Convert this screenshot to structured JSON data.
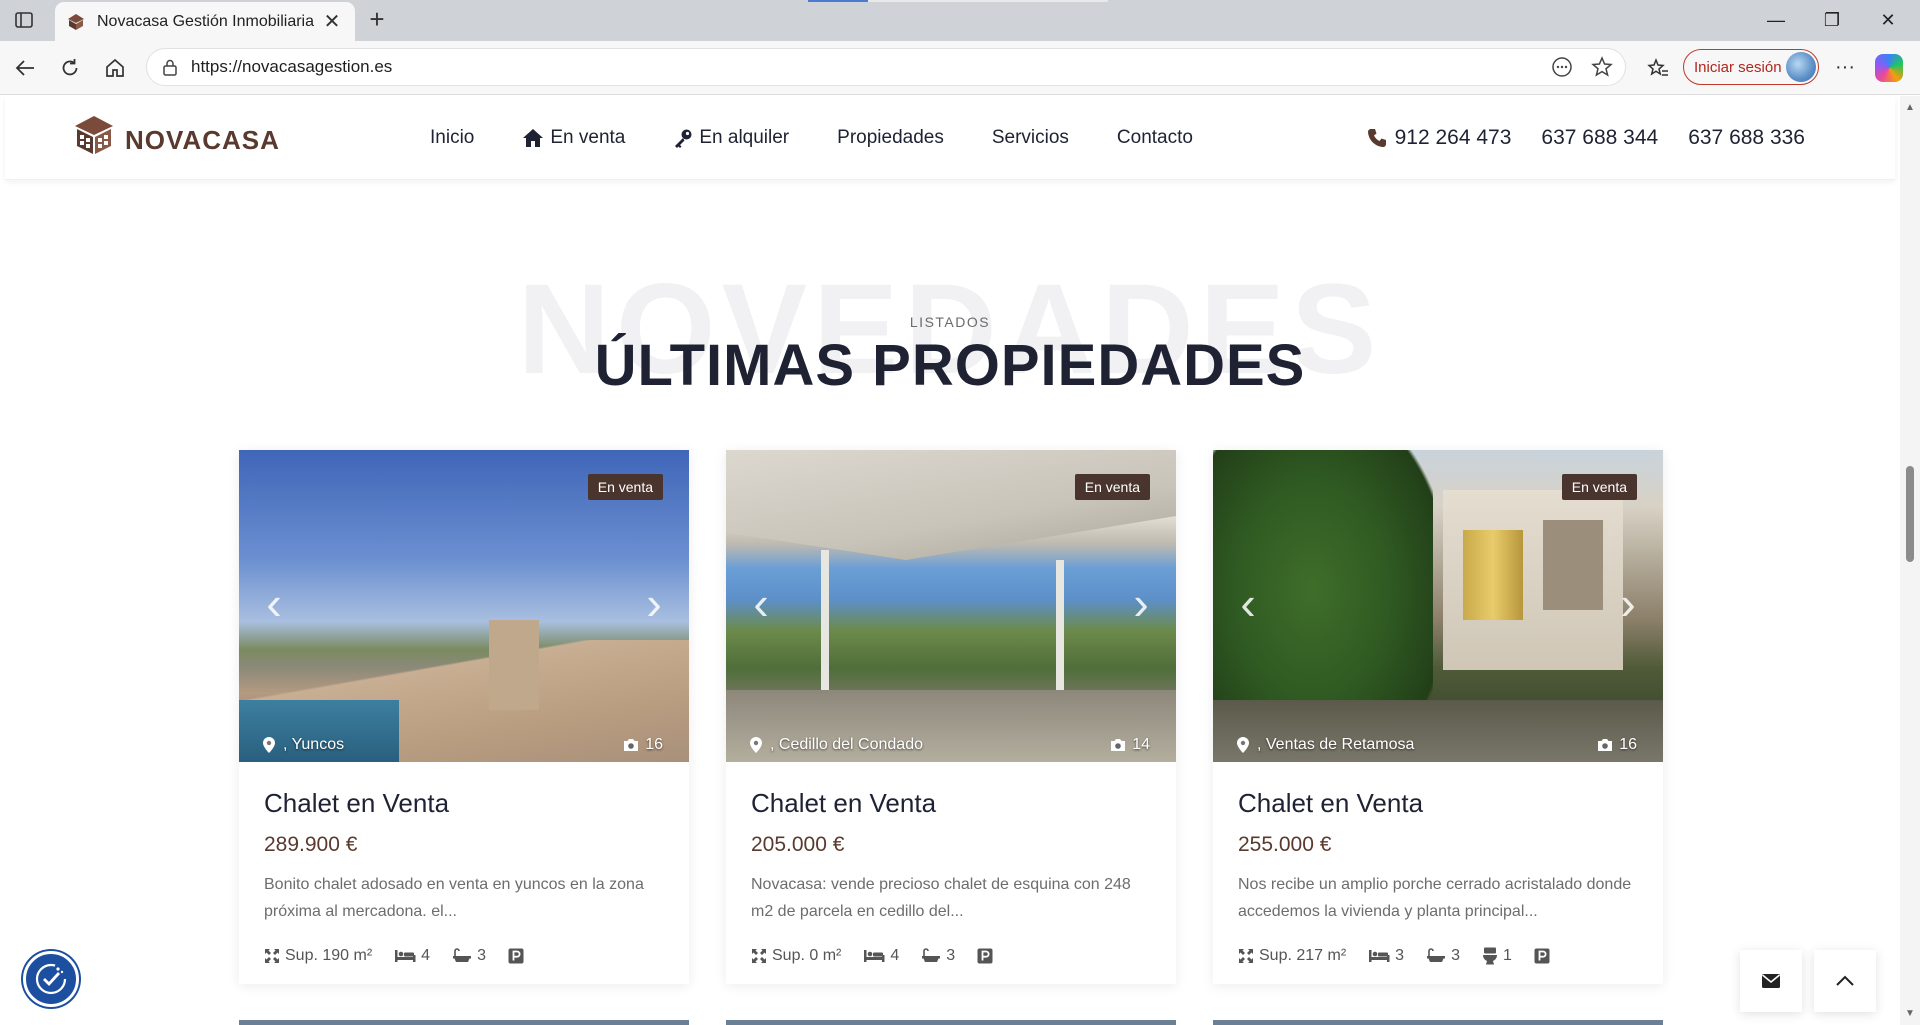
{
  "browser": {
    "tab_title": "Novacasa Gestión Inmobiliaria",
    "url": "https://novacasagestion.es",
    "signin_label": "Iniciar sesión"
  },
  "header": {
    "logo_text": "NOVACASA",
    "nav": [
      {
        "label": "Inicio",
        "icon": ""
      },
      {
        "label": "En venta",
        "icon": "home-icon"
      },
      {
        "label": "En alquiler",
        "icon": "key-icon"
      },
      {
        "label": "Propiedades",
        "icon": ""
      },
      {
        "label": "Servicios",
        "icon": ""
      },
      {
        "label": "Contacto",
        "icon": ""
      }
    ],
    "phones": [
      "912 264 473",
      "637 688 344",
      "637 688 336"
    ]
  },
  "section": {
    "background_word": "NOVEDADES",
    "kicker": "LISTADOS",
    "title": "ÚLTIMAS PROPIEDADES"
  },
  "listings": [
    {
      "badge": "En venta",
      "location": ", Yuncos",
      "photo_count": "16",
      "title": "Chalet en Venta",
      "price": "289.900 €",
      "description": "Bonito chalet adosado en venta en yuncos en la zona próxima al mercadona. el...",
      "surface": "Sup. 190 m²",
      "bedrooms": "4",
      "bathrooms": "3",
      "toilets": "",
      "parking": true
    },
    {
      "badge": "En venta",
      "location": ", Cedillo del Condado",
      "photo_count": "14",
      "title": "Chalet en Venta",
      "price": "205.000 €",
      "description": "Novacasa: vende precioso chalet de esquina con 248 m2 de parcela en cedillo del...",
      "surface": "Sup. 0 m²",
      "bedrooms": "4",
      "bathrooms": "3",
      "toilets": "",
      "parking": true
    },
    {
      "badge": "En venta",
      "location": ", Ventas de Retamosa",
      "photo_count": "16",
      "title": "Chalet en Venta",
      "price": "255.000 €",
      "description": "Nos recibe un amplio porche cerrado acristalado donde accedemos la vivienda y planta principal...",
      "surface": "Sup. 217 m²",
      "bedrooms": "3",
      "bathrooms": "3",
      "toilets": "1",
      "parking": true
    }
  ],
  "colors": {
    "brand_brown": "#5a3a2e",
    "badge_bg": "#4a342e",
    "heading": "#1f2233",
    "accessibility_blue": "#1d4fa0"
  }
}
